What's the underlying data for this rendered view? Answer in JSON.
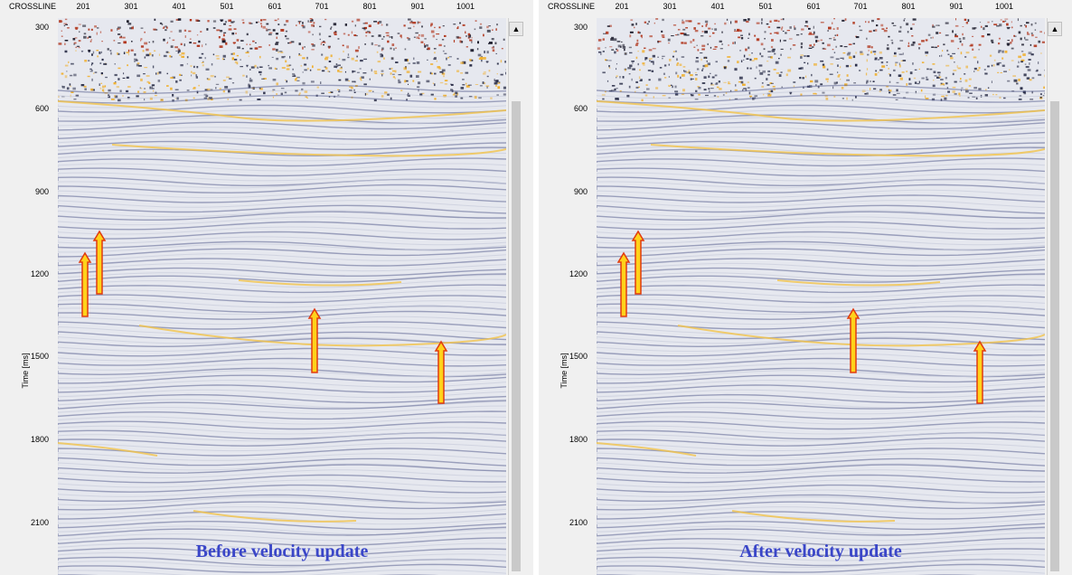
{
  "colors": {
    "caption": "#3a46c8",
    "arrow_fill": "#ffd21a",
    "arrow_stroke": "#e03a10",
    "seismic_bg": "#e6e8ef"
  },
  "panels": [
    {
      "id": "before",
      "xaxis_title": "CROSSLINE",
      "xticks": [
        "201",
        "301",
        "401",
        "501",
        "601",
        "701",
        "801",
        "901",
        "1001"
      ],
      "yticks": [
        "300",
        "600",
        "900",
        "1200",
        "1500",
        "1800",
        "2100"
      ],
      "ylabel": "Time [ms]",
      "caption": "Before velocity update"
    },
    {
      "id": "after",
      "xaxis_title": "CROSSLINE",
      "xticks": [
        "201",
        "301",
        "401",
        "501",
        "601",
        "701",
        "801",
        "901",
        "1001"
      ],
      "yticks": [
        "300",
        "600",
        "900",
        "1200",
        "1500",
        "1800",
        "2100"
      ],
      "ylabel": "Time [ms]",
      "caption": "After velocity update"
    }
  ]
}
